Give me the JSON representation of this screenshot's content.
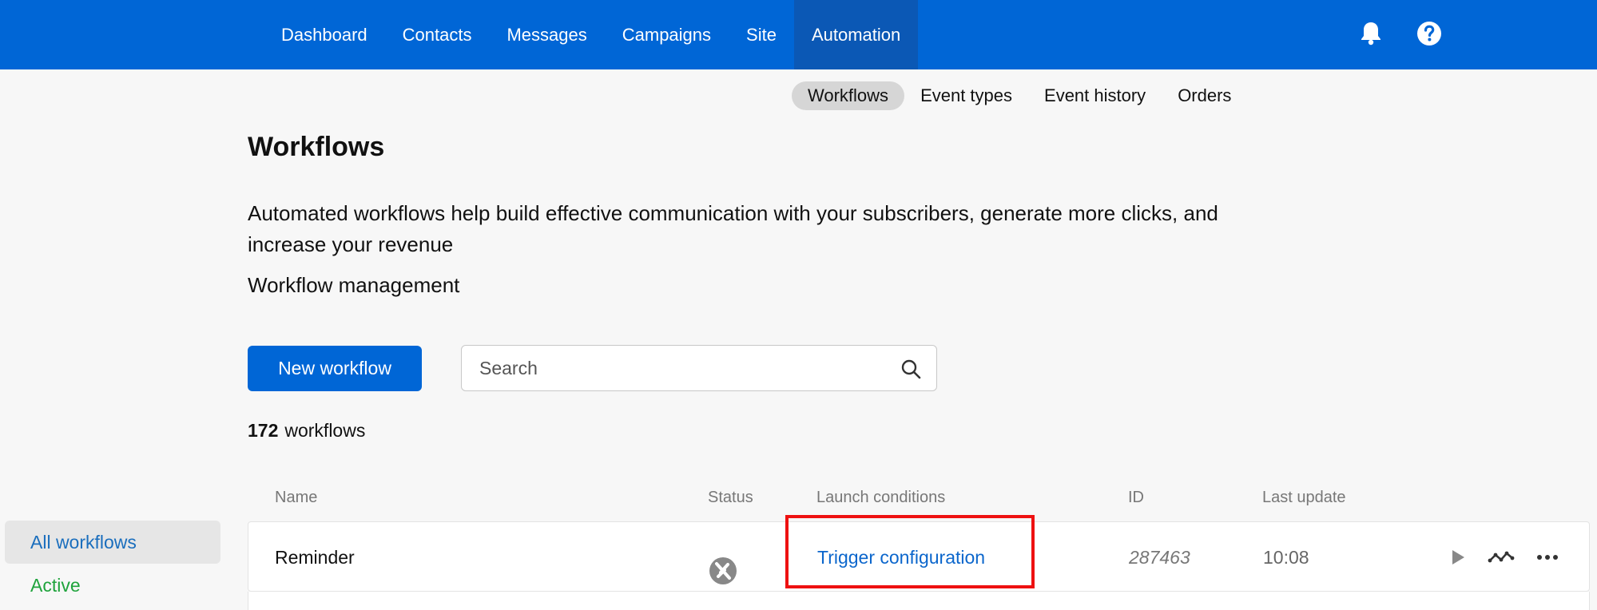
{
  "topnav": {
    "items": [
      {
        "label": "Dashboard"
      },
      {
        "label": "Contacts"
      },
      {
        "label": "Messages"
      },
      {
        "label": "Campaigns"
      },
      {
        "label": "Site"
      },
      {
        "label": "Automation"
      }
    ],
    "active": "Automation",
    "icons": [
      "bell-icon",
      "help-icon"
    ]
  },
  "subnav": {
    "items": [
      {
        "label": "Workflows"
      },
      {
        "label": "Event types"
      },
      {
        "label": "Event history"
      },
      {
        "label": "Orders"
      }
    ],
    "active": "Workflows"
  },
  "page": {
    "title": "Workflows",
    "description": "Automated workflows help build effective communication with your subscribers, generate more clicks, and increase your revenue",
    "section_label": "Workflow management"
  },
  "toolbar": {
    "new_button": "New workflow",
    "search_placeholder": "Search"
  },
  "summary": {
    "count": "172",
    "count_label": "workflows"
  },
  "sidebar": {
    "items": [
      {
        "label": "All workflows"
      },
      {
        "label": "Active"
      }
    ]
  },
  "table": {
    "headers": {
      "name": "Name",
      "status": "Status",
      "launch": "Launch conditions",
      "id": "ID",
      "updated": "Last update"
    },
    "rows": [
      {
        "name": "Reminder",
        "status_icon": "status-off-icon",
        "launch": "Trigger configuration",
        "id": "287463",
        "updated": "10:08",
        "actions": [
          "play-icon",
          "stats-icon",
          "more-icon"
        ]
      }
    ]
  },
  "colors": {
    "brand": "#0066d6",
    "link": "#0b66cc",
    "active_green": "#1fa33c",
    "highlight": "#ee1111"
  }
}
